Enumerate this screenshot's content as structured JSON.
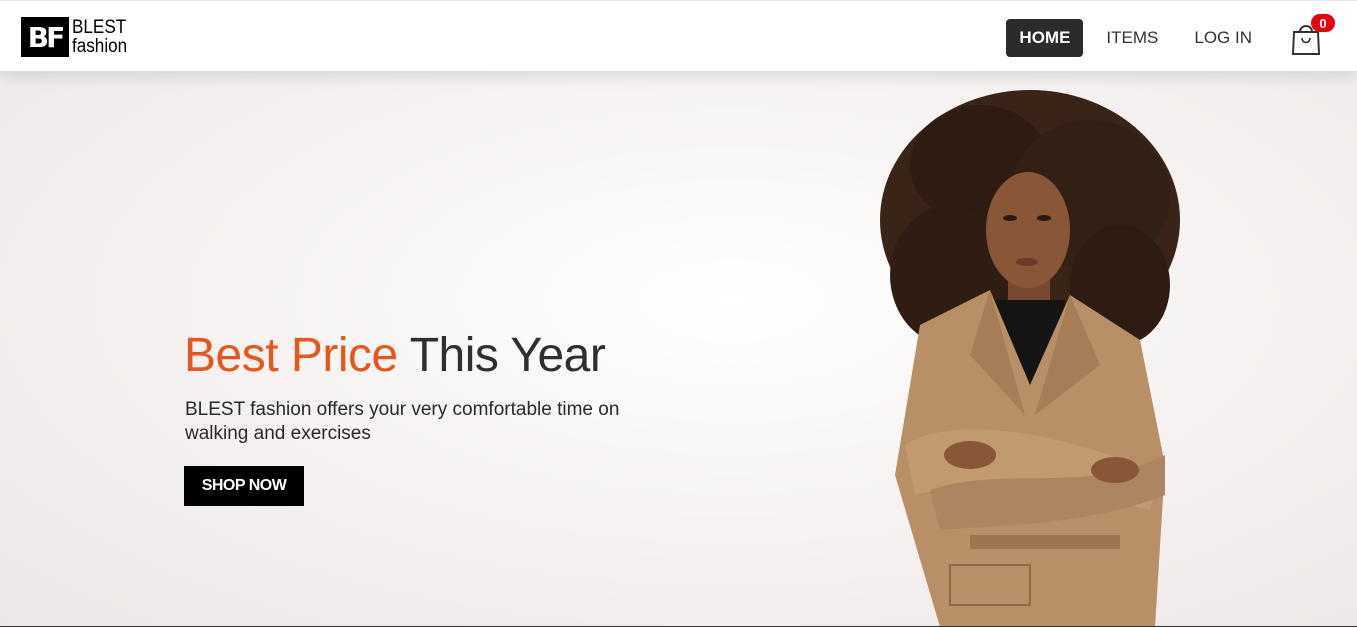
{
  "brand": {
    "mark": "BF",
    "line1": "BLEST",
    "line2": "fashion"
  },
  "nav": {
    "items": [
      {
        "label": "HOME",
        "active": true
      },
      {
        "label": "ITEMS",
        "active": false
      },
      {
        "label": "LOG IN",
        "active": false
      }
    ],
    "cart_icon": "shopping-bag-icon",
    "cart_count": "0"
  },
  "hero": {
    "title_accent": "Best Price",
    "title_rest": " This Year",
    "subtitle": "BLEST fashion offers your very comfortable time on walking and exercises",
    "cta_label": "SHOP NOW"
  },
  "colors": {
    "accent": "#e8561c",
    "active_nav": "#2b2b2b",
    "badge": "#e8000b",
    "coat": "#b88f66"
  }
}
